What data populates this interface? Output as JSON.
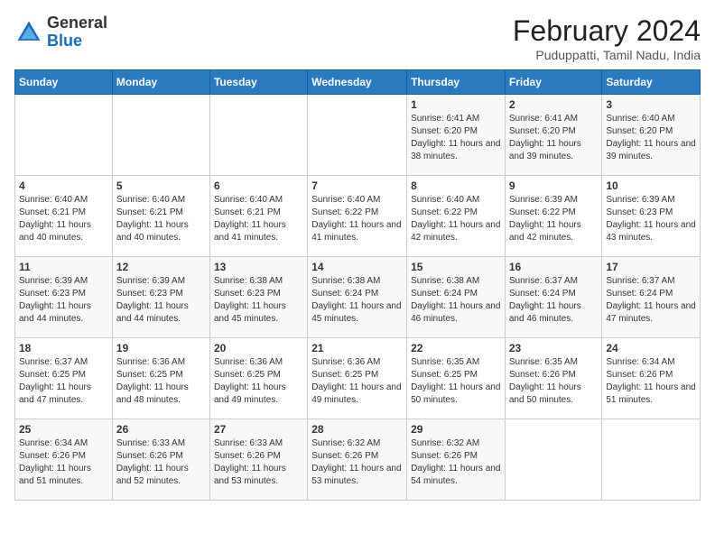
{
  "header": {
    "logo_general": "General",
    "logo_blue": "Blue",
    "title": "February 2024",
    "subtitle": "Puduppatti, Tamil Nadu, India"
  },
  "days_of_week": [
    "Sunday",
    "Monday",
    "Tuesday",
    "Wednesday",
    "Thursday",
    "Friday",
    "Saturday"
  ],
  "weeks": [
    [
      {
        "day": "",
        "info": ""
      },
      {
        "day": "",
        "info": ""
      },
      {
        "day": "",
        "info": ""
      },
      {
        "day": "",
        "info": ""
      },
      {
        "day": "1",
        "info": "Sunrise: 6:41 AM\nSunset: 6:20 PM\nDaylight: 11 hours and 38 minutes."
      },
      {
        "day": "2",
        "info": "Sunrise: 6:41 AM\nSunset: 6:20 PM\nDaylight: 11 hours and 39 minutes."
      },
      {
        "day": "3",
        "info": "Sunrise: 6:40 AM\nSunset: 6:20 PM\nDaylight: 11 hours and 39 minutes."
      }
    ],
    [
      {
        "day": "4",
        "info": "Sunrise: 6:40 AM\nSunset: 6:21 PM\nDaylight: 11 hours and 40 minutes."
      },
      {
        "day": "5",
        "info": "Sunrise: 6:40 AM\nSunset: 6:21 PM\nDaylight: 11 hours and 40 minutes."
      },
      {
        "day": "6",
        "info": "Sunrise: 6:40 AM\nSunset: 6:21 PM\nDaylight: 11 hours and 41 minutes."
      },
      {
        "day": "7",
        "info": "Sunrise: 6:40 AM\nSunset: 6:22 PM\nDaylight: 11 hours and 41 minutes."
      },
      {
        "day": "8",
        "info": "Sunrise: 6:40 AM\nSunset: 6:22 PM\nDaylight: 11 hours and 42 minutes."
      },
      {
        "day": "9",
        "info": "Sunrise: 6:39 AM\nSunset: 6:22 PM\nDaylight: 11 hours and 42 minutes."
      },
      {
        "day": "10",
        "info": "Sunrise: 6:39 AM\nSunset: 6:23 PM\nDaylight: 11 hours and 43 minutes."
      }
    ],
    [
      {
        "day": "11",
        "info": "Sunrise: 6:39 AM\nSunset: 6:23 PM\nDaylight: 11 hours and 44 minutes."
      },
      {
        "day": "12",
        "info": "Sunrise: 6:39 AM\nSunset: 6:23 PM\nDaylight: 11 hours and 44 minutes."
      },
      {
        "day": "13",
        "info": "Sunrise: 6:38 AM\nSunset: 6:23 PM\nDaylight: 11 hours and 45 minutes."
      },
      {
        "day": "14",
        "info": "Sunrise: 6:38 AM\nSunset: 6:24 PM\nDaylight: 11 hours and 45 minutes."
      },
      {
        "day": "15",
        "info": "Sunrise: 6:38 AM\nSunset: 6:24 PM\nDaylight: 11 hours and 46 minutes."
      },
      {
        "day": "16",
        "info": "Sunrise: 6:37 AM\nSunset: 6:24 PM\nDaylight: 11 hours and 46 minutes."
      },
      {
        "day": "17",
        "info": "Sunrise: 6:37 AM\nSunset: 6:24 PM\nDaylight: 11 hours and 47 minutes."
      }
    ],
    [
      {
        "day": "18",
        "info": "Sunrise: 6:37 AM\nSunset: 6:25 PM\nDaylight: 11 hours and 47 minutes."
      },
      {
        "day": "19",
        "info": "Sunrise: 6:36 AM\nSunset: 6:25 PM\nDaylight: 11 hours and 48 minutes."
      },
      {
        "day": "20",
        "info": "Sunrise: 6:36 AM\nSunset: 6:25 PM\nDaylight: 11 hours and 49 minutes."
      },
      {
        "day": "21",
        "info": "Sunrise: 6:36 AM\nSunset: 6:25 PM\nDaylight: 11 hours and 49 minutes."
      },
      {
        "day": "22",
        "info": "Sunrise: 6:35 AM\nSunset: 6:25 PM\nDaylight: 11 hours and 50 minutes."
      },
      {
        "day": "23",
        "info": "Sunrise: 6:35 AM\nSunset: 6:26 PM\nDaylight: 11 hours and 50 minutes."
      },
      {
        "day": "24",
        "info": "Sunrise: 6:34 AM\nSunset: 6:26 PM\nDaylight: 11 hours and 51 minutes."
      }
    ],
    [
      {
        "day": "25",
        "info": "Sunrise: 6:34 AM\nSunset: 6:26 PM\nDaylight: 11 hours and 51 minutes."
      },
      {
        "day": "26",
        "info": "Sunrise: 6:33 AM\nSunset: 6:26 PM\nDaylight: 11 hours and 52 minutes."
      },
      {
        "day": "27",
        "info": "Sunrise: 6:33 AM\nSunset: 6:26 PM\nDaylight: 11 hours and 53 minutes."
      },
      {
        "day": "28",
        "info": "Sunrise: 6:32 AM\nSunset: 6:26 PM\nDaylight: 11 hours and 53 minutes."
      },
      {
        "day": "29",
        "info": "Sunrise: 6:32 AM\nSunset: 6:26 PM\nDaylight: 11 hours and 54 minutes."
      },
      {
        "day": "",
        "info": ""
      },
      {
        "day": "",
        "info": ""
      }
    ]
  ]
}
